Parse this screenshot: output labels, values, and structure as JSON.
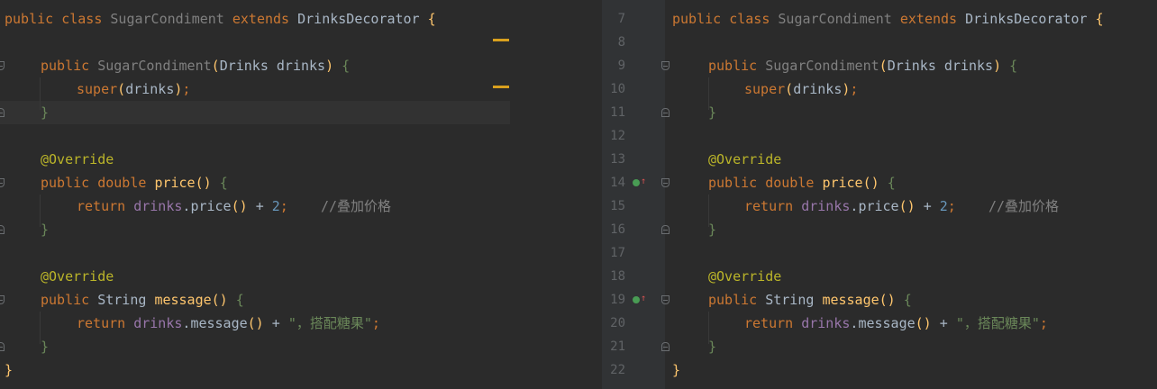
{
  "editor": {
    "left": {
      "code": {
        "class_decl": {
          "kw1": "public",
          "kw2": "class",
          "name": "SugarCondiment",
          "kw3": "extends",
          "parent": "DrinksDecorator",
          "brace": "{"
        },
        "ctor_decl": {
          "kw": "public",
          "name": "SugarCondiment",
          "param_type": "Drinks",
          "param": "drinks",
          "brace": "{"
        },
        "ctor_body": {
          "kw": "super",
          "arg": "drinks"
        },
        "close_brace": "}",
        "override": "@Override",
        "price_decl": {
          "kw1": "public",
          "type": "double",
          "name": "price",
          "brace": "{"
        },
        "price_body": {
          "kw": "return",
          "field": "drinks",
          "call": "price",
          "op": "+",
          "num": "2",
          "comment": "//叠加价格"
        },
        "message_decl": {
          "kw": "public",
          "type": "String",
          "name": "message",
          "brace": "{"
        },
        "message_body": {
          "kw": "return",
          "field": "drinks",
          "call": "message",
          "op": "+",
          "str": "\"，搭配糖果\""
        }
      }
    },
    "right": {
      "line_numbers": [
        "7",
        "8",
        "9",
        "10",
        "11",
        "12",
        "13",
        "14",
        "15",
        "16",
        "17",
        "18",
        "19",
        "20",
        "21",
        "22"
      ],
      "code": {
        "class_decl": {
          "kw1": "public",
          "kw2": "class",
          "name": "SugarCondiment",
          "kw3": "extends",
          "parent": "DrinksDecorator",
          "brace": "{"
        },
        "ctor_decl": {
          "kw": "public",
          "name": "SugarCondiment",
          "param_type": "Drinks",
          "param": "drinks",
          "brace": "{"
        },
        "ctor_body": {
          "kw": "super",
          "arg": "drinks"
        },
        "close_brace": "}",
        "override": "@Override",
        "price_decl": {
          "kw1": "public",
          "type": "double",
          "name": "price",
          "brace": "{"
        },
        "price_body": {
          "kw": "return",
          "field": "drinks",
          "call": "price",
          "op": "+",
          "num": "2",
          "comment": "//叠加价格"
        },
        "message_decl": {
          "kw": "public",
          "type": "String",
          "name": "message",
          "brace": "{"
        },
        "message_body": {
          "kw": "return",
          "field": "drinks",
          "call": "message",
          "op": "+",
          "str": "\"，搭配糖果\""
        }
      }
    }
  },
  "colors": {
    "background": "#2b2b2b",
    "gutter": "#313335",
    "keyword": "#cc7832",
    "function": "#ffc66d",
    "annotation": "#bbb529",
    "field": "#9876aa",
    "number": "#6897bb",
    "string": "#6a8759",
    "comment": "#808080",
    "text": "#a9b7c6",
    "marker": "#d9a01e",
    "override_icon": "#499c54"
  },
  "icons": {
    "fold": "fold-marker-icon",
    "override": "overrides-method-icon",
    "marker": "warning-stripe-marker"
  }
}
